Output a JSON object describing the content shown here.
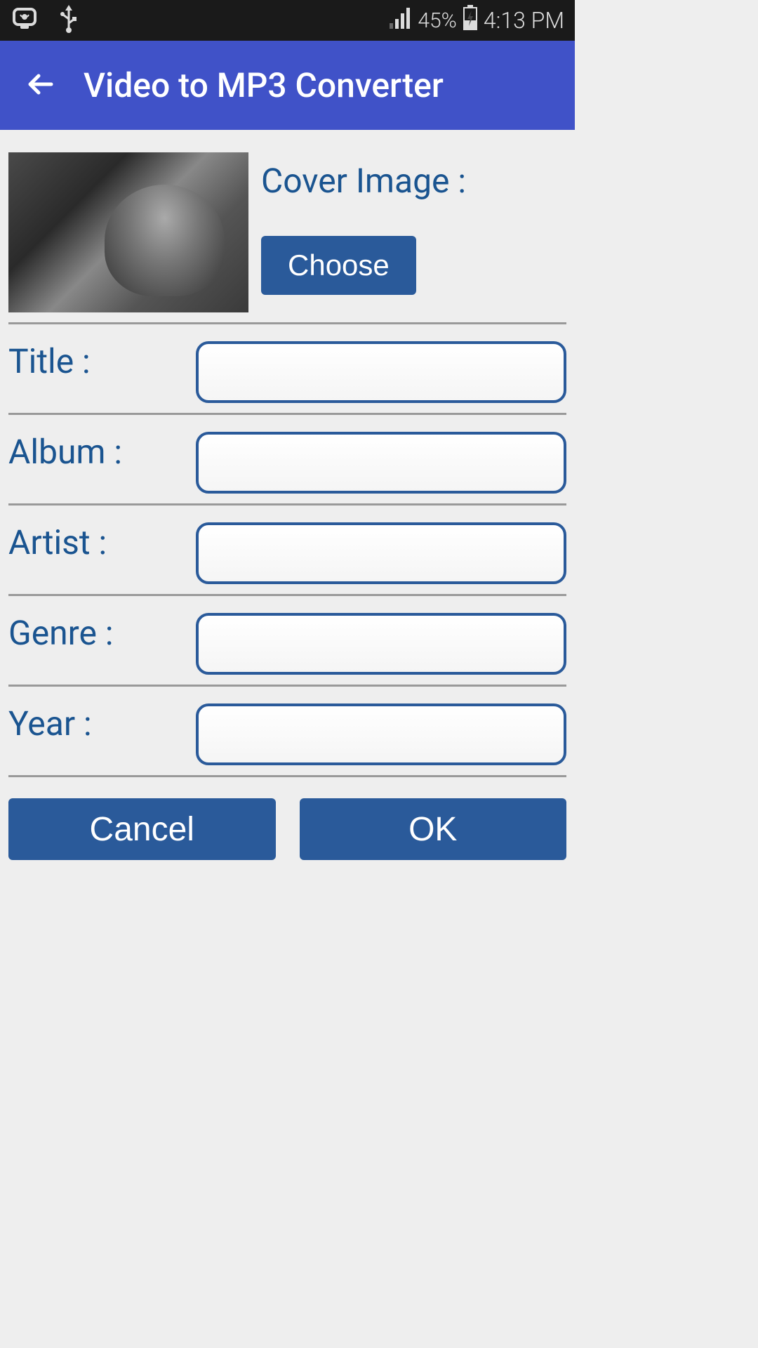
{
  "status_bar": {
    "battery_percent": "45%",
    "time": "4:13 PM",
    "icons": {
      "cast": "cast-icon",
      "usb": "usb-icon",
      "signal": "signal-icon",
      "battery": "battery-charging-icon"
    }
  },
  "app_bar": {
    "title": "Video to MP3 Converter"
  },
  "cover": {
    "label": "Cover Image :",
    "choose_label": "Choose"
  },
  "form": {
    "title": {
      "label": "Title :",
      "value": ""
    },
    "album": {
      "label": "Album :",
      "value": ""
    },
    "artist": {
      "label": "Artist :",
      "value": ""
    },
    "genre": {
      "label": "Genre :",
      "value": ""
    },
    "year": {
      "label": "Year :",
      "value": ""
    }
  },
  "actions": {
    "cancel_label": "Cancel",
    "ok_label": "OK"
  }
}
